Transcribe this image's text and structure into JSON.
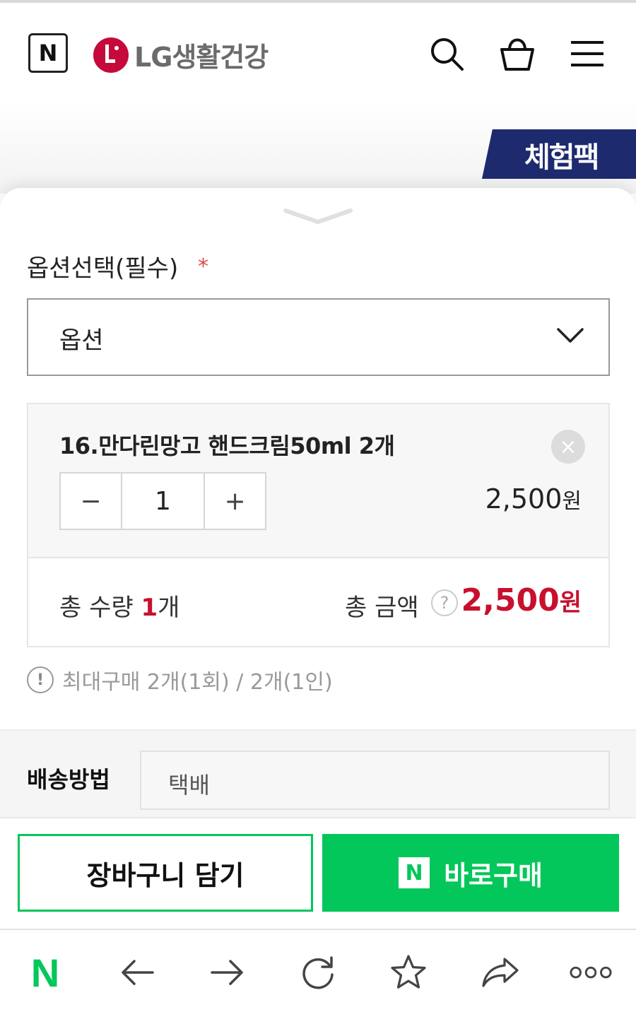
{
  "header": {
    "naver_mark": "N",
    "brand_name": "LG생활건강"
  },
  "badge": {
    "text": "체험팩"
  },
  "option": {
    "label": "옵션선택(필수)",
    "required_mark": "*",
    "select_value": "옵션"
  },
  "item": {
    "name": "16.만다린망고 핸드크림50ml 2개",
    "remove_glyph": "×",
    "minus_glyph": "−",
    "plus_glyph": "+",
    "quantity": "1",
    "price": "2,500",
    "price_unit": "원"
  },
  "totals": {
    "qty_label": "총 수량",
    "qty_value": "1",
    "qty_unit": "개",
    "amount_label": "총 금액",
    "help_glyph": "?",
    "amount_value": "2,500",
    "amount_unit": "원"
  },
  "notice": {
    "icon_glyph": "!",
    "text": "최대구매 2개(1회) / 2개(1인)"
  },
  "shipping": {
    "label": "배송방법",
    "value": "택배"
  },
  "actions": {
    "cart_label": "장바구니 담기",
    "buy_mark": "N",
    "buy_label": "바로구매"
  },
  "browser_bar": {
    "home_mark": "N"
  },
  "colors": {
    "accent_green": "#03c75a",
    "price_red": "#c8102e",
    "badge_navy": "#1d2a6e",
    "lg_red": "#c5093a"
  },
  "icons": [
    "naver-n-icon",
    "lg-logo-icon",
    "search-icon",
    "cart-icon",
    "menu-icon",
    "chevron-down-icon",
    "close-icon",
    "help-icon",
    "info-icon",
    "back-arrow-icon",
    "forward-arrow-icon",
    "refresh-icon",
    "star-icon",
    "share-icon",
    "more-icon"
  ]
}
